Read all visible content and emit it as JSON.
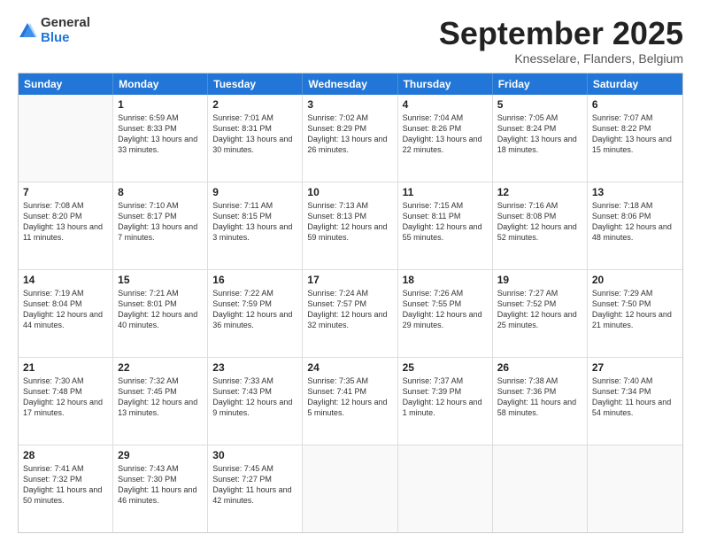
{
  "logo": {
    "general": "General",
    "blue": "Blue"
  },
  "title": {
    "month": "September 2025",
    "location": "Knesselare, Flanders, Belgium"
  },
  "header_days": [
    "Sunday",
    "Monday",
    "Tuesday",
    "Wednesday",
    "Thursday",
    "Friday",
    "Saturday"
  ],
  "weeks": [
    [
      {
        "day": "",
        "sunrise": "",
        "sunset": "",
        "daylight": ""
      },
      {
        "day": "1",
        "sunrise": "Sunrise: 6:59 AM",
        "sunset": "Sunset: 8:33 PM",
        "daylight": "Daylight: 13 hours and 33 minutes."
      },
      {
        "day": "2",
        "sunrise": "Sunrise: 7:01 AM",
        "sunset": "Sunset: 8:31 PM",
        "daylight": "Daylight: 13 hours and 30 minutes."
      },
      {
        "day": "3",
        "sunrise": "Sunrise: 7:02 AM",
        "sunset": "Sunset: 8:29 PM",
        "daylight": "Daylight: 13 hours and 26 minutes."
      },
      {
        "day": "4",
        "sunrise": "Sunrise: 7:04 AM",
        "sunset": "Sunset: 8:26 PM",
        "daylight": "Daylight: 13 hours and 22 minutes."
      },
      {
        "day": "5",
        "sunrise": "Sunrise: 7:05 AM",
        "sunset": "Sunset: 8:24 PM",
        "daylight": "Daylight: 13 hours and 18 minutes."
      },
      {
        "day": "6",
        "sunrise": "Sunrise: 7:07 AM",
        "sunset": "Sunset: 8:22 PM",
        "daylight": "Daylight: 13 hours and 15 minutes."
      }
    ],
    [
      {
        "day": "7",
        "sunrise": "Sunrise: 7:08 AM",
        "sunset": "Sunset: 8:20 PM",
        "daylight": "Daylight: 13 hours and 11 minutes."
      },
      {
        "day": "8",
        "sunrise": "Sunrise: 7:10 AM",
        "sunset": "Sunset: 8:17 PM",
        "daylight": "Daylight: 13 hours and 7 minutes."
      },
      {
        "day": "9",
        "sunrise": "Sunrise: 7:11 AM",
        "sunset": "Sunset: 8:15 PM",
        "daylight": "Daylight: 13 hours and 3 minutes."
      },
      {
        "day": "10",
        "sunrise": "Sunrise: 7:13 AM",
        "sunset": "Sunset: 8:13 PM",
        "daylight": "Daylight: 12 hours and 59 minutes."
      },
      {
        "day": "11",
        "sunrise": "Sunrise: 7:15 AM",
        "sunset": "Sunset: 8:11 PM",
        "daylight": "Daylight: 12 hours and 55 minutes."
      },
      {
        "day": "12",
        "sunrise": "Sunrise: 7:16 AM",
        "sunset": "Sunset: 8:08 PM",
        "daylight": "Daylight: 12 hours and 52 minutes."
      },
      {
        "day": "13",
        "sunrise": "Sunrise: 7:18 AM",
        "sunset": "Sunset: 8:06 PM",
        "daylight": "Daylight: 12 hours and 48 minutes."
      }
    ],
    [
      {
        "day": "14",
        "sunrise": "Sunrise: 7:19 AM",
        "sunset": "Sunset: 8:04 PM",
        "daylight": "Daylight: 12 hours and 44 minutes."
      },
      {
        "day": "15",
        "sunrise": "Sunrise: 7:21 AM",
        "sunset": "Sunset: 8:01 PM",
        "daylight": "Daylight: 12 hours and 40 minutes."
      },
      {
        "day": "16",
        "sunrise": "Sunrise: 7:22 AM",
        "sunset": "Sunset: 7:59 PM",
        "daylight": "Daylight: 12 hours and 36 minutes."
      },
      {
        "day": "17",
        "sunrise": "Sunrise: 7:24 AM",
        "sunset": "Sunset: 7:57 PM",
        "daylight": "Daylight: 12 hours and 32 minutes."
      },
      {
        "day": "18",
        "sunrise": "Sunrise: 7:26 AM",
        "sunset": "Sunset: 7:55 PM",
        "daylight": "Daylight: 12 hours and 29 minutes."
      },
      {
        "day": "19",
        "sunrise": "Sunrise: 7:27 AM",
        "sunset": "Sunset: 7:52 PM",
        "daylight": "Daylight: 12 hours and 25 minutes."
      },
      {
        "day": "20",
        "sunrise": "Sunrise: 7:29 AM",
        "sunset": "Sunset: 7:50 PM",
        "daylight": "Daylight: 12 hours and 21 minutes."
      }
    ],
    [
      {
        "day": "21",
        "sunrise": "Sunrise: 7:30 AM",
        "sunset": "Sunset: 7:48 PM",
        "daylight": "Daylight: 12 hours and 17 minutes."
      },
      {
        "day": "22",
        "sunrise": "Sunrise: 7:32 AM",
        "sunset": "Sunset: 7:45 PM",
        "daylight": "Daylight: 12 hours and 13 minutes."
      },
      {
        "day": "23",
        "sunrise": "Sunrise: 7:33 AM",
        "sunset": "Sunset: 7:43 PM",
        "daylight": "Daylight: 12 hours and 9 minutes."
      },
      {
        "day": "24",
        "sunrise": "Sunrise: 7:35 AM",
        "sunset": "Sunset: 7:41 PM",
        "daylight": "Daylight: 12 hours and 5 minutes."
      },
      {
        "day": "25",
        "sunrise": "Sunrise: 7:37 AM",
        "sunset": "Sunset: 7:39 PM",
        "daylight": "Daylight: 12 hours and 1 minute."
      },
      {
        "day": "26",
        "sunrise": "Sunrise: 7:38 AM",
        "sunset": "Sunset: 7:36 PM",
        "daylight": "Daylight: 11 hours and 58 minutes."
      },
      {
        "day": "27",
        "sunrise": "Sunrise: 7:40 AM",
        "sunset": "Sunset: 7:34 PM",
        "daylight": "Daylight: 11 hours and 54 minutes."
      }
    ],
    [
      {
        "day": "28",
        "sunrise": "Sunrise: 7:41 AM",
        "sunset": "Sunset: 7:32 PM",
        "daylight": "Daylight: 11 hours and 50 minutes."
      },
      {
        "day": "29",
        "sunrise": "Sunrise: 7:43 AM",
        "sunset": "Sunset: 7:30 PM",
        "daylight": "Daylight: 11 hours and 46 minutes."
      },
      {
        "day": "30",
        "sunrise": "Sunrise: 7:45 AM",
        "sunset": "Sunset: 7:27 PM",
        "daylight": "Daylight: 11 hours and 42 minutes."
      },
      {
        "day": "",
        "sunrise": "",
        "sunset": "",
        "daylight": ""
      },
      {
        "day": "",
        "sunrise": "",
        "sunset": "",
        "daylight": ""
      },
      {
        "day": "",
        "sunrise": "",
        "sunset": "",
        "daylight": ""
      },
      {
        "day": "",
        "sunrise": "",
        "sunset": "",
        "daylight": ""
      }
    ]
  ]
}
